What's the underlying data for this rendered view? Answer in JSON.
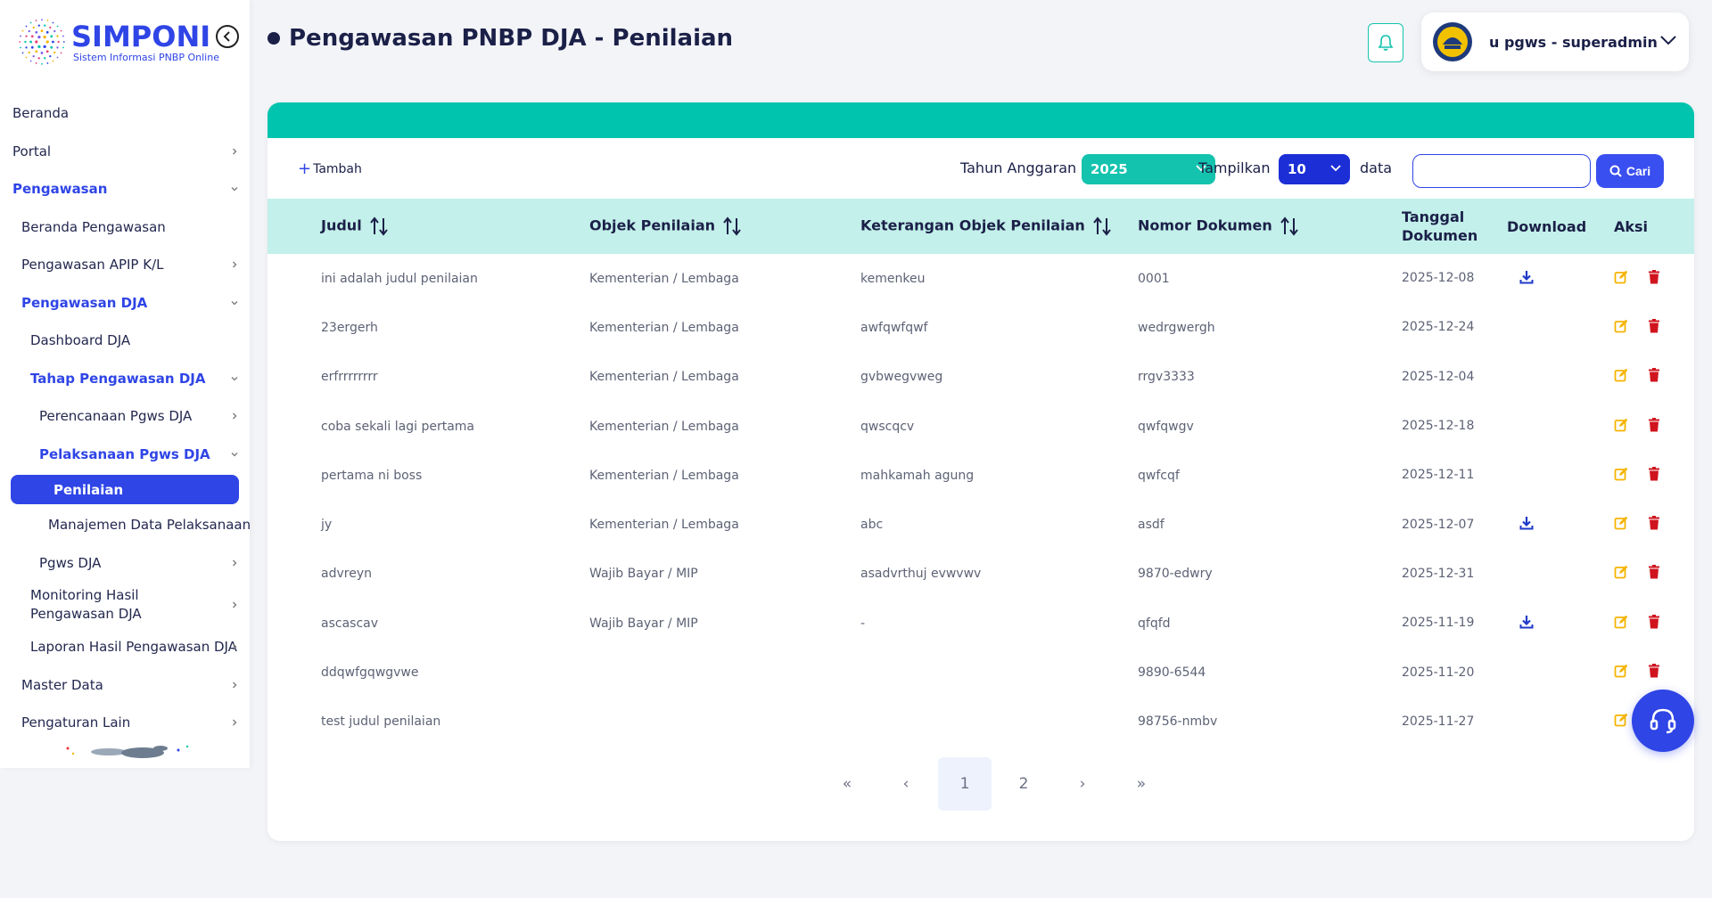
{
  "brand": {
    "name": "SIMPONI",
    "tagline": "Sistem Informasi PNBP Online"
  },
  "sidebar": {
    "items": [
      {
        "label": "Beranda",
        "indent": 14,
        "active": false,
        "chevron": ""
      },
      {
        "label": "Portal",
        "indent": 14,
        "active": false,
        "chevron": "right"
      },
      {
        "label": "Pengawasan",
        "indent": 14,
        "active": true,
        "chevron": "down"
      },
      {
        "label": "Beranda Pengawasan",
        "indent": 24,
        "active": false,
        "chevron": ""
      },
      {
        "label": "Pengawasan APIP K/L",
        "indent": 24,
        "active": false,
        "chevron": "right"
      },
      {
        "label": "Pengawasan DJA",
        "indent": 24,
        "active": true,
        "chevron": "down"
      },
      {
        "label": "Dashboard DJA",
        "indent": 34,
        "active": false,
        "chevron": ""
      },
      {
        "label": "Tahap Pengawasan DJA",
        "indent": 34,
        "active": true,
        "chevron": "down"
      },
      {
        "label": "Perencanaan Pgws DJA",
        "indent": 44,
        "active": false,
        "chevron": "right"
      },
      {
        "label": "Pelaksanaan Pgws DJA",
        "indent": 44,
        "active": true,
        "chevron": "down"
      },
      {
        "label": "Penilaian",
        "indent": 46,
        "active": true,
        "chevron": "",
        "current": true
      },
      {
        "label": "Manajemen Data Pelaksanaan",
        "indent": 54,
        "active": false,
        "chevron": ""
      },
      {
        "label": "Pgws DJA",
        "indent": 44,
        "active": false,
        "chevron": "right"
      },
      {
        "label": "Monitoring Hasil Pengawasan DJA",
        "indent": 34,
        "active": false,
        "chevron": "right",
        "two_line": true
      },
      {
        "label": "Laporan Hasil Pengawasan DJA",
        "indent": 34,
        "active": false,
        "chevron": "right"
      },
      {
        "label": "Master Data",
        "indent": 24,
        "active": false,
        "chevron": "right"
      },
      {
        "label": "Pengaturan Lain",
        "indent": 24,
        "active": false,
        "chevron": "right"
      }
    ]
  },
  "header": {
    "title": "Pengawasan PNBP DJA - Penilaian",
    "user_name": "u pgws - superadmin"
  },
  "toolbar": {
    "add_label": "Tambah",
    "year_label": "Tahun Anggaran",
    "year_value": "2025",
    "show_label": "Tampilkan",
    "show_value": "10",
    "data_label": "data",
    "search_placeholder": "",
    "search_button": "Cari"
  },
  "table": {
    "columns": [
      "Judul",
      "Objek Penilaian",
      "Keterangan Objek Penilaian",
      "Nomor Dokumen",
      "Tanggal Dokumen",
      "Download",
      "Aksi"
    ],
    "rows": [
      {
        "judul": "ini adalah judul penilaian",
        "objek": "Kementerian / Lembaga",
        "keterangan": "kemenkeu",
        "nomor": "0001",
        "tanggal": "2025-12-08",
        "download": true
      },
      {
        "judul": "23ergerh",
        "objek": "Kementerian / Lembaga",
        "keterangan": "awfqwfqwf",
        "nomor": "wedrgwergh",
        "tanggal": "2025-12-24",
        "download": false
      },
      {
        "judul": "erfrrrrrrrr",
        "objek": "Kementerian / Lembaga",
        "keterangan": "gvbwegvweg",
        "nomor": "rrgv3333",
        "tanggal": "2025-12-04",
        "download": false
      },
      {
        "judul": "coba sekali lagi pertama",
        "objek": "Kementerian / Lembaga",
        "keterangan": "qwscqcv",
        "nomor": "qwfqwgv",
        "tanggal": "2025-12-18",
        "download": false
      },
      {
        "judul": "pertama ni boss",
        "objek": "Kementerian / Lembaga",
        "keterangan": "mahkamah agung",
        "nomor": "qwfcqf",
        "tanggal": "2025-12-11",
        "download": false
      },
      {
        "judul": "jy",
        "objek": "Kementerian / Lembaga",
        "keterangan": "abc",
        "nomor": "asdf",
        "tanggal": "2025-12-07",
        "download": true
      },
      {
        "judul": "advreyn",
        "objek": "Wajib Bayar / MIP",
        "keterangan": "asadvrthuj evwvwv",
        "nomor": "9870-edwry",
        "tanggal": "2025-12-31",
        "download": false
      },
      {
        "judul": "ascascav",
        "objek": "Wajib Bayar / MIP",
        "keterangan": "-",
        "nomor": "qfqfd",
        "tanggal": "2025-11-19",
        "download": true
      },
      {
        "judul": "ddqwfgqwgvwe",
        "objek": "",
        "keterangan": "",
        "nomor": "9890-6544",
        "tanggal": "2025-11-20",
        "download": false
      },
      {
        "judul": "test judul penilaian",
        "objek": "",
        "keterangan": "",
        "nomor": "98756-nmbv",
        "tanggal": "2025-11-27",
        "download": false
      }
    ]
  },
  "pagination": {
    "first": "«",
    "prev": "‹",
    "pages": [
      "1",
      "2"
    ],
    "current": "1",
    "next": "›",
    "last": "»"
  },
  "icons": {
    "notification": "bell-icon",
    "help": "headset-icon",
    "download": "download-icon",
    "edit": "edit-icon",
    "delete": "trash-icon"
  },
  "colors": {
    "primary": "#2f45e6",
    "teal": "#00c4ad",
    "table_header": "#c3f0ea",
    "edit": "#f5b400",
    "delete": "#d0141e",
    "download": "#1e3ac8"
  }
}
